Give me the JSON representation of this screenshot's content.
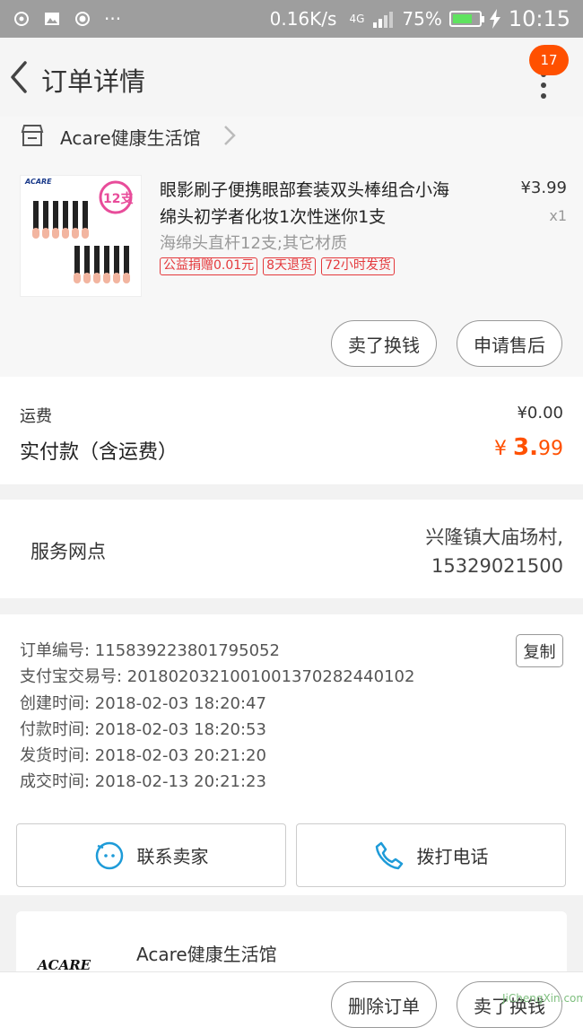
{
  "status_bar": {
    "network_speed": "0.16K/s",
    "network_type": "4G",
    "battery": "75%",
    "battery_level": 0.75,
    "time": "10:15"
  },
  "header": {
    "title": "订单详情",
    "notification_count": "17"
  },
  "shop": {
    "name": "Acare健康生活馆"
  },
  "item": {
    "name": "眼影刷子便携眼部套装双头棒组合小海绵头初学者化妆1次性迷你1支",
    "sku": "海绵头直杆12支;其它材质",
    "tags": [
      "公益捐赠0.01元",
      "8天退货",
      "72小时发货"
    ],
    "price": "¥3.99",
    "qty": "x1",
    "thumb_badge": "12支",
    "thumb_brand": "ACARE",
    "sell_button": "卖了换钱",
    "aftersale_button": "申请售后"
  },
  "fee": {
    "shipping_label": "运费",
    "shipping_value": "¥0.00",
    "paid_label": "实付款（含运费）",
    "paid_currency": "¥",
    "paid_int": "3.",
    "paid_dec": "99"
  },
  "service": {
    "label": "服务网点",
    "address": "兴隆镇大庙场村,",
    "phone": "15329021500"
  },
  "info": {
    "lines": [
      "订单编号: 115839223801795052",
      "支付宝交易号: 2018020321001001370282440102",
      "创建时间: 2018-02-03 18:20:47",
      "付款时间: 2018-02-03 18:20:53",
      "发货时间: 2018-02-03 20:21:20",
      "成交时间: 2018-02-13 20:21:23"
    ],
    "copy_button": "复制"
  },
  "contact": {
    "seller_label": "联系卖家",
    "call_label": "拨打电话"
  },
  "shop_card": {
    "name": "Acare健康生活馆",
    "logo_text": "ACARE"
  },
  "bottom": {
    "delete_button": "删除订单",
    "sell_button": "卖了换钱"
  },
  "watermark": "JiChengXin.com",
  "colors": {
    "accent": "#ff5000",
    "tag_red": "#e4393c",
    "link_blue": "#1e9bd8",
    "statusbar": "#9e9e9e"
  }
}
